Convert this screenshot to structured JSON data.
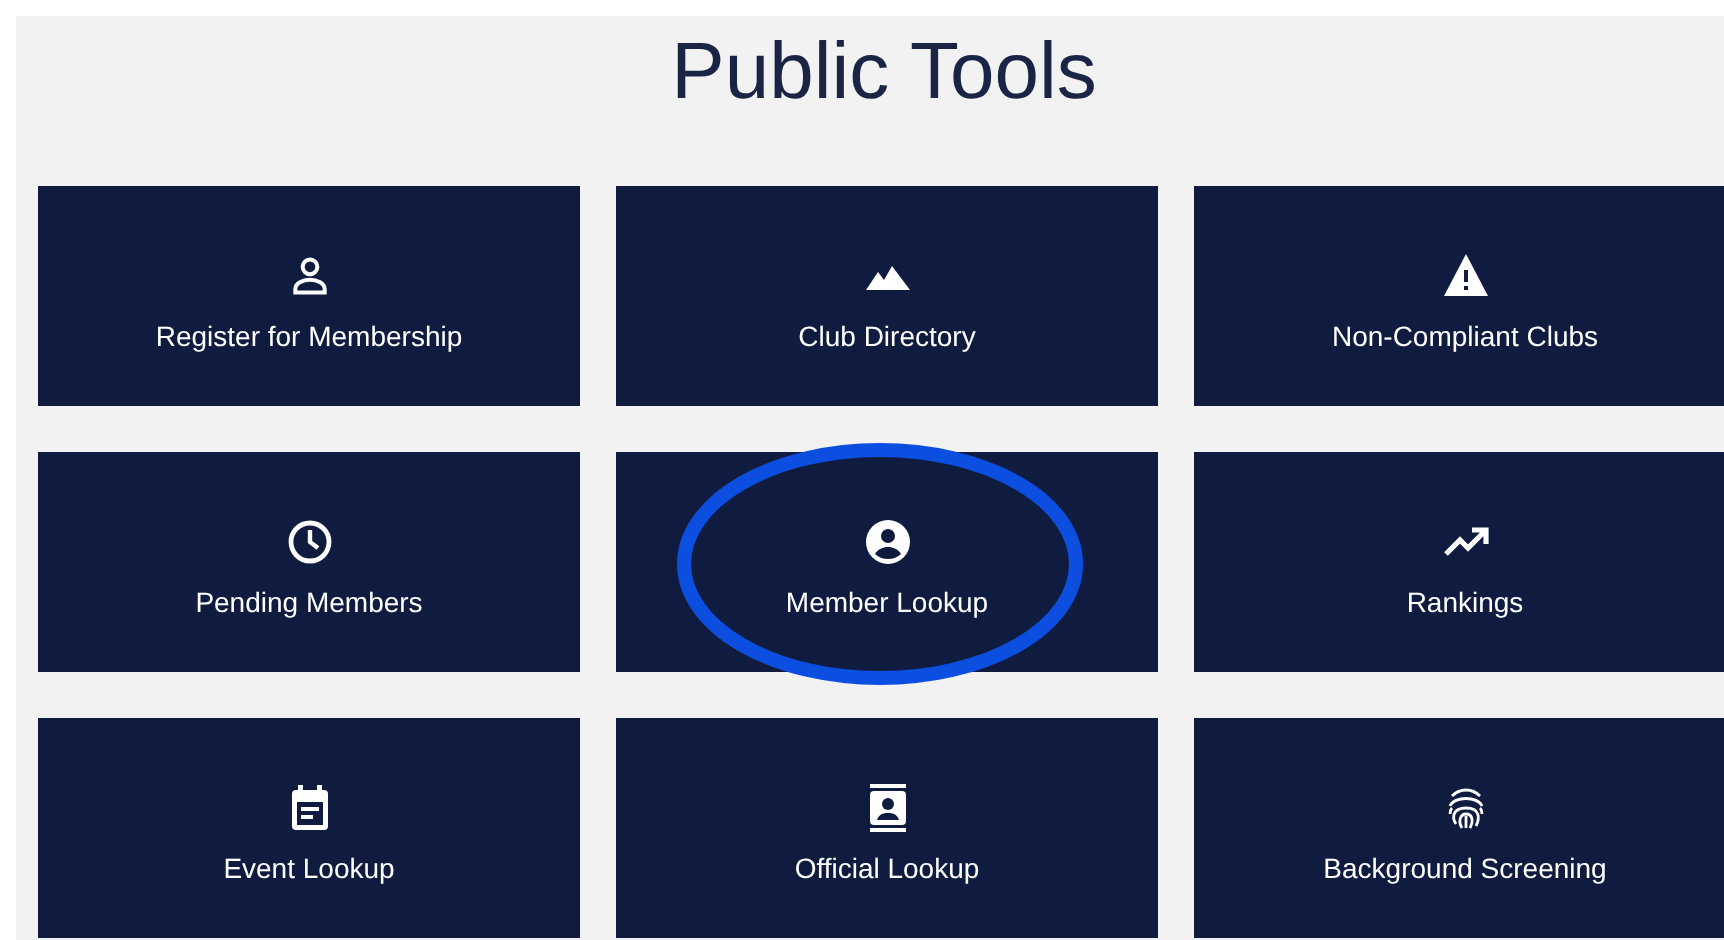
{
  "title": "Public Tools",
  "tools": [
    {
      "label": "Register for Membership",
      "kind": "person",
      "circled": false
    },
    {
      "label": "Club Directory",
      "kind": "mountains",
      "circled": false
    },
    {
      "label": "Non-Compliant Clubs",
      "kind": "warning",
      "circled": false
    },
    {
      "label": "Pending Members",
      "kind": "clock",
      "circled": false
    },
    {
      "label": "Member Lookup",
      "kind": "account",
      "circled": true
    },
    {
      "label": "Rankings",
      "kind": "trend",
      "circled": false
    },
    {
      "label": "Event Lookup",
      "kind": "calendar",
      "circled": false
    },
    {
      "label": "Official Lookup",
      "kind": "badge",
      "circled": false
    },
    {
      "label": "Background Screening",
      "kind": "fingerprint",
      "circled": false
    }
  ]
}
